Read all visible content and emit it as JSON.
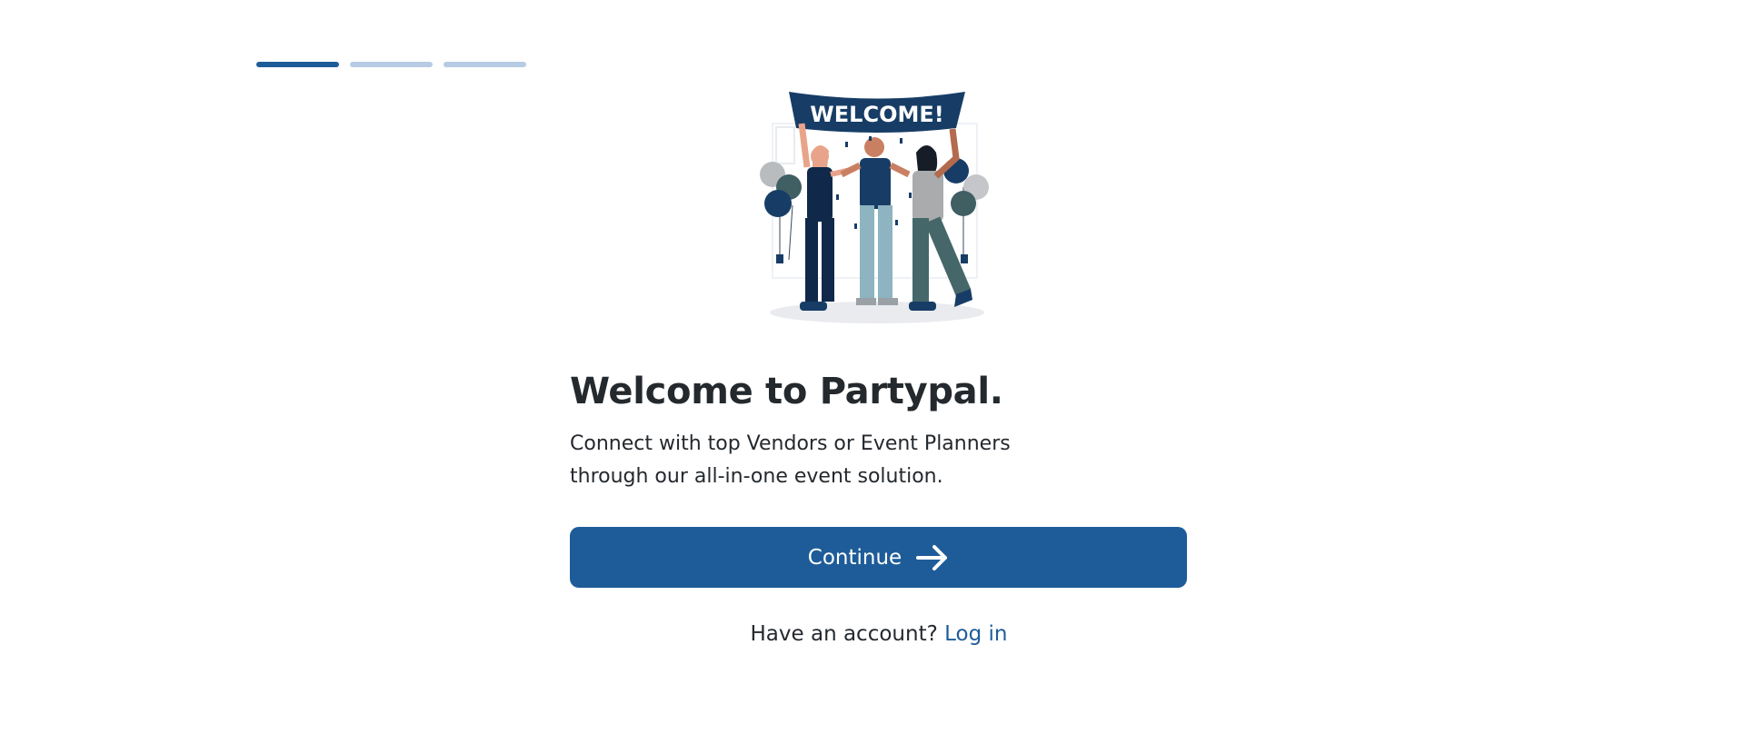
{
  "progress": {
    "steps": 3,
    "current": 1
  },
  "illustration": {
    "icon": "welcome-party-illustration",
    "banner_text": "WELCOME!"
  },
  "main": {
    "title": "Welcome to Partypal.",
    "subtitle": "Connect with top Vendors or Event Planners through our all-in-one event solution.",
    "continue_label": "Continue",
    "continue_icon": "arrow-right-icon"
  },
  "footer": {
    "prompt": "Have an account?",
    "login_label": "Log in"
  },
  "colors": {
    "primary": "#1e5c99",
    "progress_inactive": "#b7cbe4",
    "text": "#24292e"
  }
}
